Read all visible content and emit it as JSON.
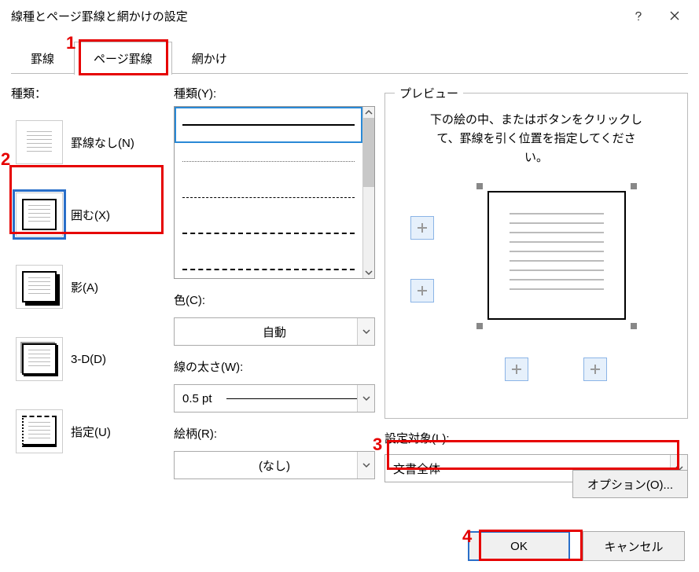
{
  "title": "線種とページ罫線と網かけの設定",
  "tabs": {
    "t0": "罫線",
    "t1": "ページ罫線",
    "t2": "網かけ"
  },
  "col1": {
    "header": "種類：",
    "items": {
      "none": "罫線なし(N)",
      "box": "囲む(X)",
      "shadow": "影(A)",
      "threed": "3-D(D)",
      "custom": "指定(U)"
    }
  },
  "col2": {
    "style_label": "種類(Y):",
    "color_label": "色(C):",
    "color_value": "自動",
    "width_label": "線の太さ(W):",
    "width_value": "0.5 pt",
    "art_label": "絵柄(R):",
    "art_value": "(なし)"
  },
  "col3": {
    "legend": "プレビュー",
    "hint1": "下の絵の中、またはボタンをクリックし",
    "hint2": "て、罫線を引く位置を指定してくださ",
    "hint3": "い。",
    "apply_label": "設定対象(L):",
    "apply_value": "文書全体",
    "options_btn": "オプション(O)..."
  },
  "footer": {
    "ok": "OK",
    "cancel": "キャンセル"
  },
  "annot": {
    "n1": "1",
    "n2": "2",
    "n3": "3",
    "n4": "4"
  }
}
